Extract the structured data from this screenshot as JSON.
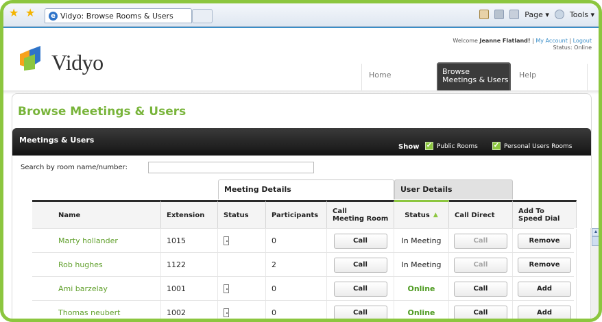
{
  "browser": {
    "tab_title": "Vidyo: Browse Rooms & Users",
    "tools": [
      "Page ▾",
      "Tools ▾"
    ]
  },
  "header": {
    "logo_text": "Vidyo",
    "welcome_prefix": "Welcome",
    "user_name": "Jeanne Flatland!",
    "my_account": "My Account",
    "logout": "Logout",
    "status_line": "Status: Online",
    "nav": {
      "home": "Home",
      "active_line1": "Browse",
      "active_line2": "Meetings & Users",
      "help": "Help"
    }
  },
  "page": {
    "title": "Browse Meetings & Users",
    "panel_title": "Meetings & Users",
    "show_label": "Show",
    "filter_public": "Public Rooms",
    "filter_personal": "Personal Users Rooms",
    "search_label": "Search by room name/number:",
    "search_value": "",
    "group_meeting": "Meeting Details",
    "group_user": "User Details"
  },
  "table": {
    "columns": {
      "name": "Name",
      "extension": "Extension",
      "status": "Status",
      "participants": "Participants",
      "call_room_1": "Call",
      "call_room_2": "Meeting Room",
      "user_status": "Status",
      "call_direct": "Call Direct",
      "speed_1": "Add To",
      "speed_2": "Speed Dial"
    },
    "rows": [
      {
        "name": "Marty hollander",
        "ext": "1015",
        "door": true,
        "participants": "0",
        "call": "Call",
        "status": "In Meeting",
        "direct": "Call",
        "speed": "Remove"
      },
      {
        "name": "Rob hughes",
        "ext": "1122",
        "door": false,
        "participants": "2",
        "call": "Call",
        "status": "In Meeting",
        "direct": "Call",
        "speed": "Remove"
      },
      {
        "name": "Ami barzelay",
        "ext": "1001",
        "door": true,
        "participants": "0",
        "call": "Call",
        "status": "Online",
        "direct": "Call",
        "speed": "Add"
      },
      {
        "name": "Thomas neubert",
        "ext": "1002",
        "door": true,
        "participants": "0",
        "call": "Call",
        "status": "Online",
        "direct": "Call",
        "speed": "Add"
      }
    ]
  },
  "colors": {
    "accent": "#8cc63f",
    "online": "#4c9a1f",
    "name_link": "#5f9f2a"
  }
}
